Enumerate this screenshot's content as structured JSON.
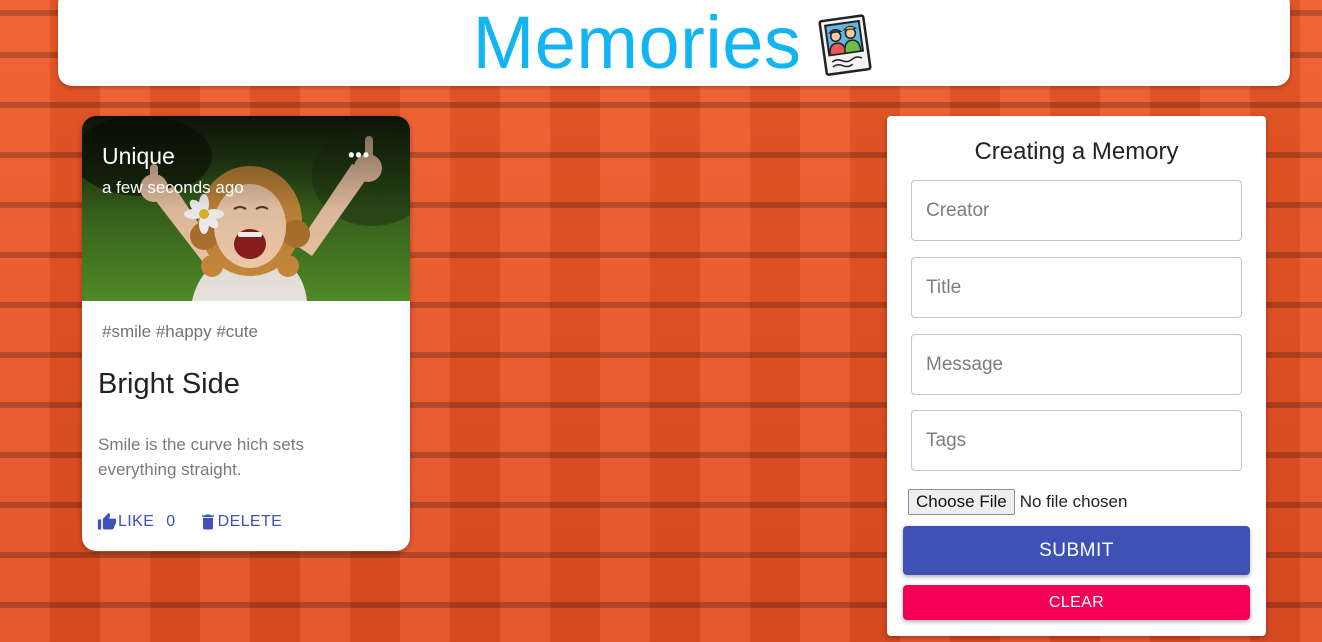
{
  "header": {
    "title": "Memories",
    "title_color": "#12b4f2",
    "logo_icon": "photo-memories-icon"
  },
  "post": {
    "creator": "Unique",
    "time": "a few seconds ago",
    "more_icon": "more-horizontal-icon",
    "image_description_icon": "smiling-girl-photo",
    "tags": "#smile #happy #cute",
    "title": "Bright Side",
    "message": "Smile is the curve hich sets everything straight.",
    "like_label": "LIKE",
    "like_count": "0",
    "delete_label": "DELETE",
    "accent_color": "#3f51b5"
  },
  "form": {
    "heading": "Creating a Memory",
    "creator_placeholder": "Creator",
    "title_placeholder": "Title",
    "message_placeholder": "Message",
    "tags_placeholder": "Tags",
    "file_button_label": "Choose File",
    "file_status": "No file chosen",
    "submit_label": "SUBMIT",
    "clear_label": "CLEAR",
    "submit_color": "#3f51b5",
    "clear_color": "#f50057"
  }
}
